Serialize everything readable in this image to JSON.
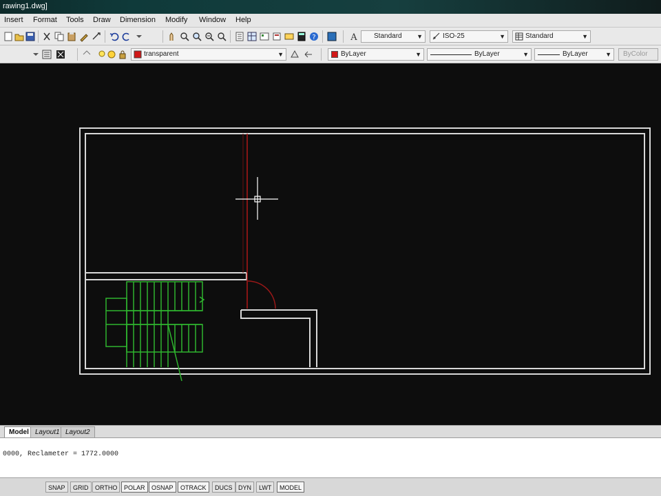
{
  "window": {
    "title": "rawing1.dwg]"
  },
  "menu": [
    {
      "id": "insert",
      "label": "Insert"
    },
    {
      "id": "format",
      "label": "Format"
    },
    {
      "id": "tools",
      "label": "Tools"
    },
    {
      "id": "draw",
      "label": "Draw"
    },
    {
      "id": "dimension",
      "label": "Dimension"
    },
    {
      "id": "modify",
      "label": "Modify"
    },
    {
      "id": "window",
      "label": "Window"
    },
    {
      "id": "help",
      "label": "Help"
    }
  ],
  "styles": {
    "text_style": "Standard",
    "dim_style": "ISO-25",
    "table_style": "Standard"
  },
  "layers": {
    "current_layer": "transparent",
    "color": "ByLayer",
    "linetype": "ByLayer",
    "lineweight": "ByLayer",
    "plotstyle": "ByColor",
    "layer_color_hex": "#d01818"
  },
  "tabs": [
    {
      "label": "Model",
      "active": true
    },
    {
      "label": "Layout1",
      "active": false
    },
    {
      "label": "Layout2",
      "active": false
    }
  ],
  "command": {
    "line1": "0000,  Reclameter  =  1772.0000",
    "line2": ""
  },
  "status": [
    {
      "label": "SNAP",
      "on": false
    },
    {
      "label": "GRID",
      "on": false
    },
    {
      "label": "ORTHO",
      "on": false
    },
    {
      "label": "POLAR",
      "on": true
    },
    {
      "label": "OSNAP",
      "on": true
    },
    {
      "label": "OTRACK",
      "on": true
    },
    {
      "label": "DUCS",
      "on": false
    },
    {
      "label": "DYN",
      "on": false
    },
    {
      "label": "LWT",
      "on": false
    },
    {
      "label": "MODEL",
      "on": true
    }
  ],
  "drawing_colors": {
    "walls": "#d8d8d8",
    "stairs": "#2fb52f",
    "centerline": "#b01818",
    "crosshair": "#ffffff",
    "background": "#0d0d0d"
  }
}
